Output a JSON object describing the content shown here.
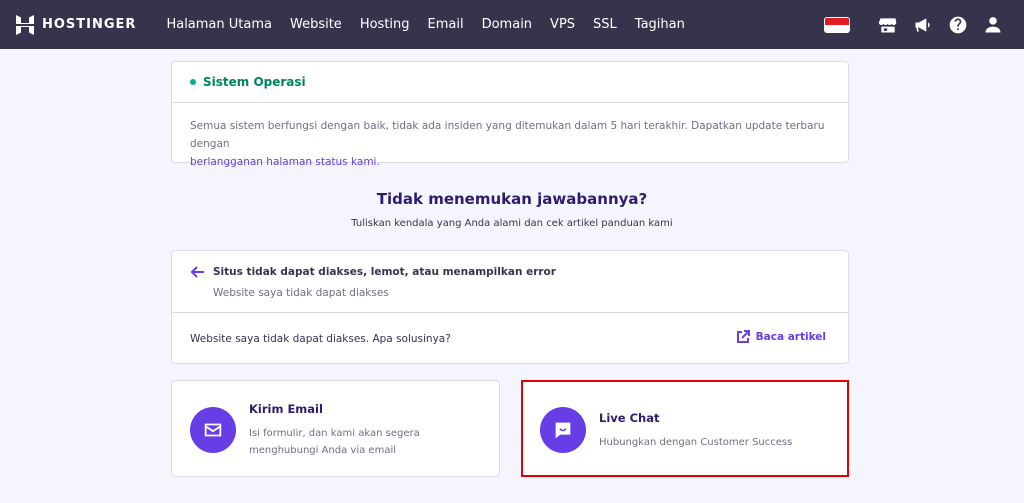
{
  "header": {
    "brand": "HOSTINGER",
    "nav": [
      "Halaman Utama",
      "Website",
      "Hosting",
      "Email",
      "Domain",
      "VPS",
      "SSL",
      "Tagihan"
    ],
    "right_icons": [
      "indonesia-flag",
      "store-icon",
      "megaphone-icon",
      "help-icon",
      "user-icon"
    ]
  },
  "status": {
    "title": "Sistem Operasi",
    "body": "Semua sistem berfungsi dengan baik, tidak ada insiden yang ditemukan dalam 5 hari terakhir. Dapatkan update terbaru dengan",
    "link": "berlangganan halaman status kami."
  },
  "help": {
    "heading": "Tidak menemukan jawabannya?",
    "subheading": "Tuliskan kendala yang Anda alami dan cek artikel panduan kami"
  },
  "article": {
    "title": "Situs tidak dapat diakses, lemot, atau menampilkan error",
    "subtitle": "Website saya tidak dapat diakses",
    "question": "Website saya tidak dapat diakses. Apa solusinya?",
    "read_label": "Baca artikel"
  },
  "contact": {
    "email": {
      "title": "Kirim Email",
      "desc": "Isi formulir, dan kami akan segera menghubungi Anda via email"
    },
    "chat": {
      "title": "Live Chat",
      "desc": "Hubungkan dengan Customer Success"
    }
  },
  "colors": {
    "topbar": "#36344d",
    "accent": "#673de6",
    "status_green": "#008361",
    "highlight_border": "#e60000"
  }
}
